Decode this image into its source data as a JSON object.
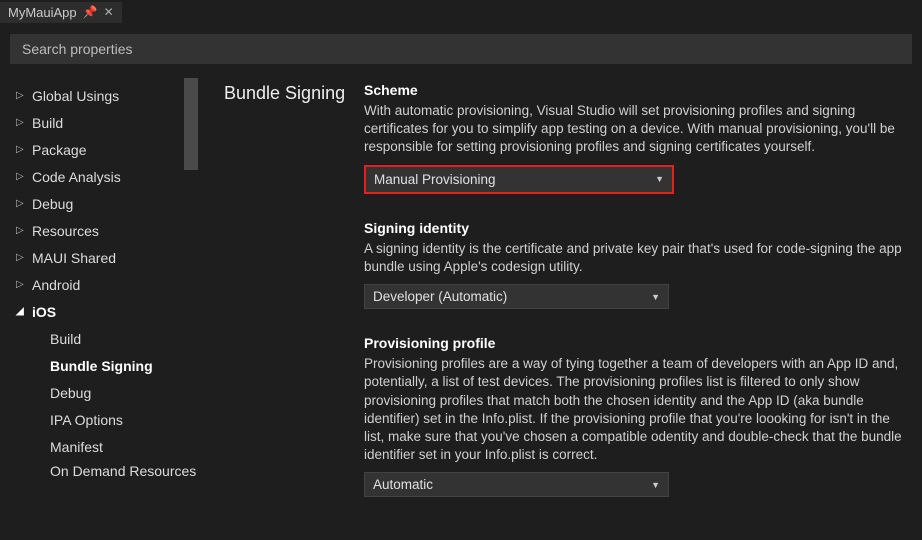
{
  "tab": {
    "title": "MyMauiApp"
  },
  "search": {
    "placeholder": "Search properties"
  },
  "sidebar": {
    "items": [
      {
        "label": "Global Usings"
      },
      {
        "label": "Build"
      },
      {
        "label": "Package"
      },
      {
        "label": "Code Analysis"
      },
      {
        "label": "Debug"
      },
      {
        "label": "Resources"
      },
      {
        "label": "MAUI Shared"
      },
      {
        "label": "Android"
      },
      {
        "label": "iOS"
      }
    ],
    "ios_sub": [
      {
        "label": "Build"
      },
      {
        "label": "Bundle Signing"
      },
      {
        "label": "Debug"
      },
      {
        "label": "IPA Options"
      },
      {
        "label": "Manifest"
      },
      {
        "label": "On Demand Resources"
      }
    ]
  },
  "section": {
    "title": "Bundle Signing"
  },
  "scheme": {
    "label": "Scheme",
    "desc": "With automatic provisioning, Visual Studio will set provisioning profiles and signing certificates for you to simplify app testing on a device. With manual provisioning, you'll be responsible for setting provisioning profiles and signing certificates yourself.",
    "value": "Manual Provisioning"
  },
  "identity": {
    "label": "Signing identity",
    "desc": "A signing identity is the certificate and private key pair that's used for code-signing the app bundle using Apple's codesign utility.",
    "value": "Developer (Automatic)"
  },
  "profile": {
    "label": "Provisioning profile",
    "desc": "Provisioning profiles are a way of tying together a team of developers with an App ID and, potentially, a list of test devices. The provisioning profiles list is filtered to only show provisioning profiles that match both the chosen identity and the App ID (aka bundle identifier) set in the Info.plist. If the provisioning profile that you're loooking for isn't in the list, make sure that you've chosen a compatible odentity and double-check that the bundle identifier set in your Info.plist is correct.",
    "value": "Automatic"
  }
}
